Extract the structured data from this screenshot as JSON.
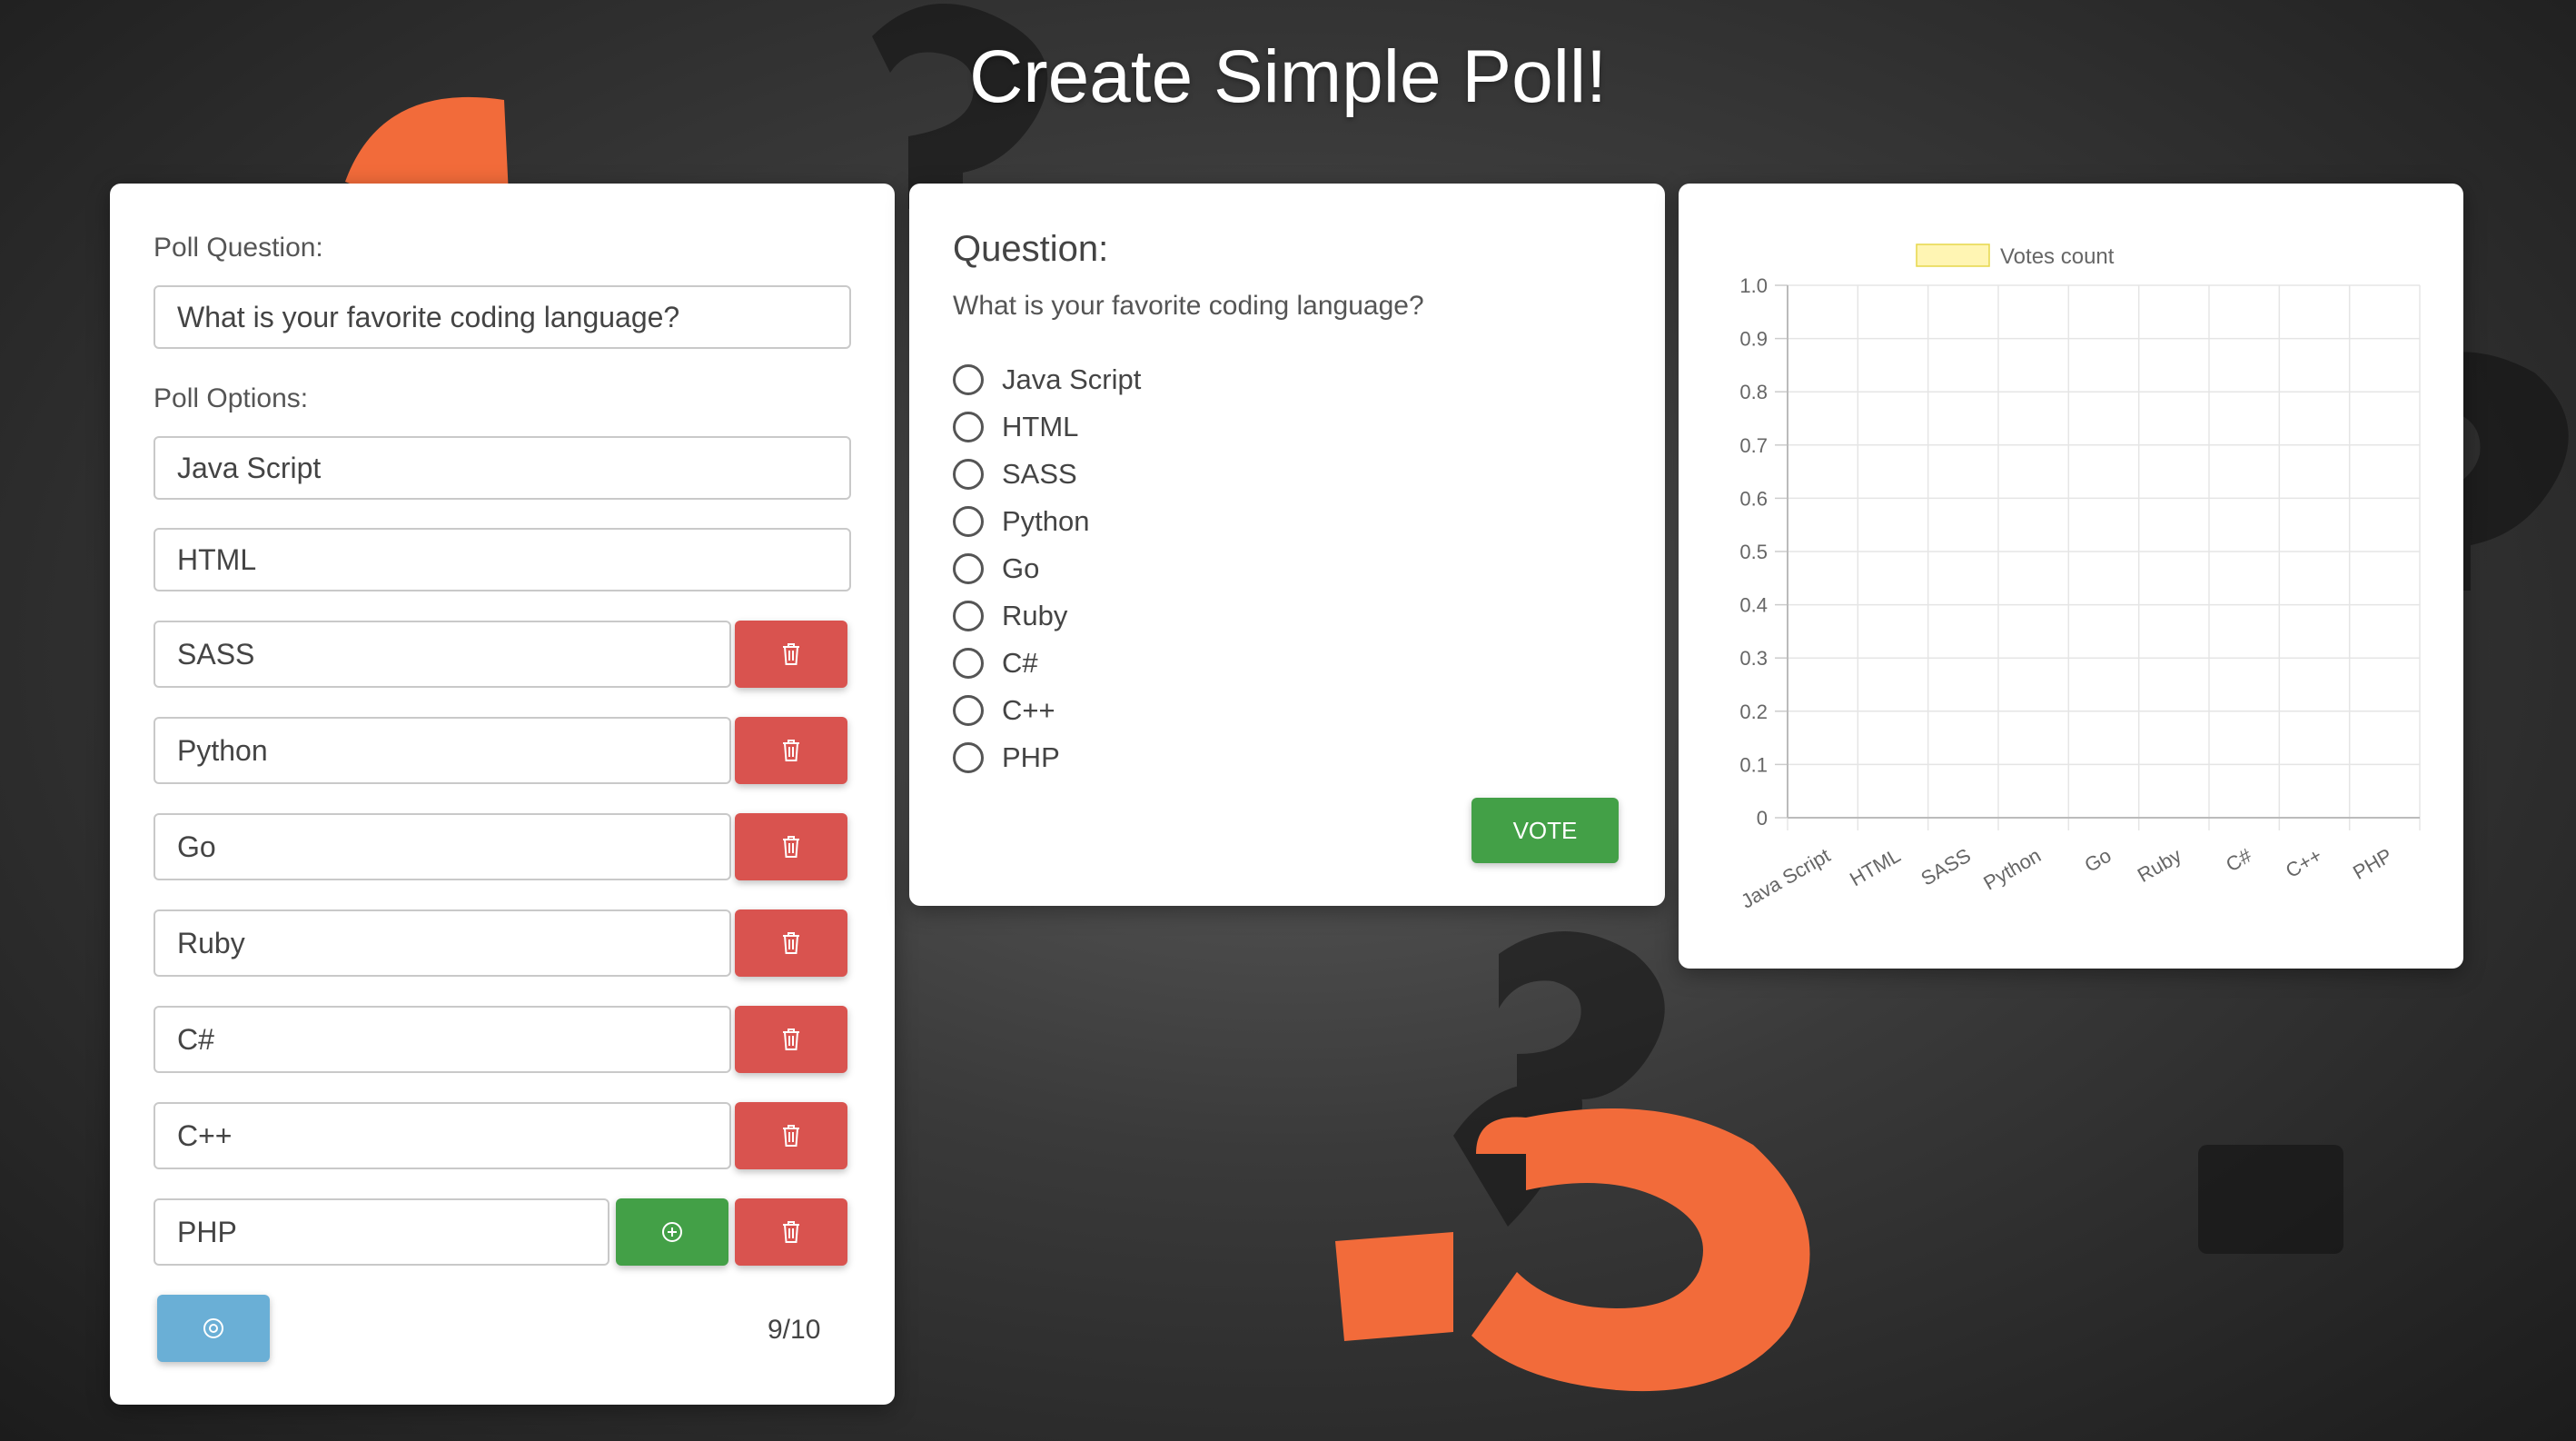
{
  "page": {
    "title": "Create Simple Poll!"
  },
  "editor": {
    "question_label": "Poll Question:",
    "question_value": "What is your favorite coding language?",
    "options_label": "Poll Options:",
    "options": [
      "Java Script",
      "HTML",
      "SASS",
      "Python",
      "Go",
      "Ruby",
      "C#",
      "C++",
      "PHP"
    ],
    "counter": "9/10",
    "icons": {
      "delete": "trash-icon",
      "add": "plus-circle-icon",
      "reset": "target-icon"
    },
    "colors": {
      "delete": "#d9534f",
      "add": "#43a047",
      "reset": "#6aafd6"
    }
  },
  "vote": {
    "heading": "Question:",
    "question": "What is your favorite coding language?",
    "options": [
      "Java Script",
      "HTML",
      "SASS",
      "Python",
      "Go",
      "Ruby",
      "C#",
      "C++",
      "PHP"
    ],
    "button": "VOTE"
  },
  "chart_data": {
    "type": "bar",
    "legend": "Votes count",
    "legend_position": "top",
    "categories": [
      "Java Script",
      "HTML",
      "SASS",
      "Python",
      "Go",
      "Ruby",
      "C#",
      "C++",
      "PHP"
    ],
    "series": [
      {
        "name": "Votes count",
        "values": [
          0,
          0,
          0,
          0,
          0,
          0,
          0,
          0,
          0
        ],
        "color": "#fff5b3"
      }
    ],
    "yticks": [
      "1.0",
      "0.9",
      "0.8",
      "0.7",
      "0.6",
      "0.5",
      "0.4",
      "0.3",
      "0.2",
      "0.1",
      "0"
    ],
    "ylim": [
      0,
      1
    ],
    "grid": true
  }
}
